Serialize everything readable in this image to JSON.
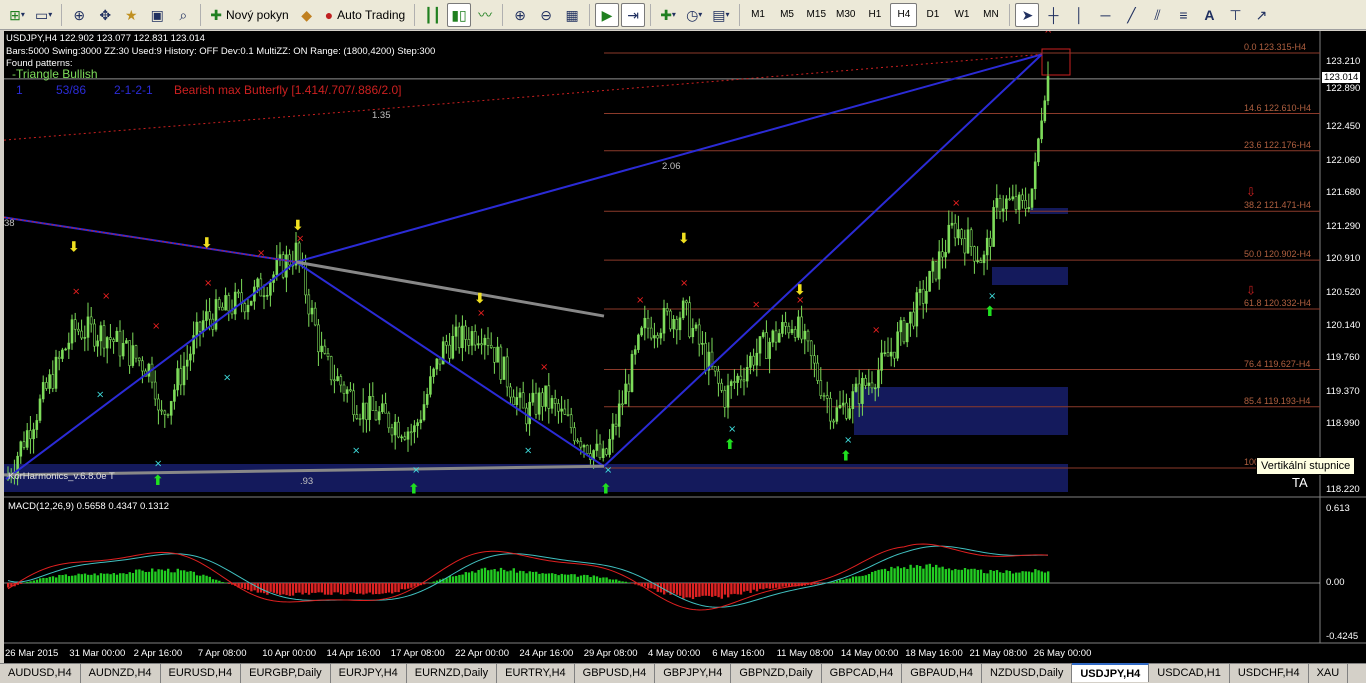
{
  "toolbar": {
    "new_order_label": "Nový pokyn",
    "auto_trading_label": "Auto Trading",
    "timeframes": [
      "M1",
      "M5",
      "M15",
      "M30",
      "H1",
      "H4",
      "D1",
      "W1",
      "MN"
    ],
    "active_timeframe": "H4"
  },
  "chart": {
    "header_line1": "USDJPY,H4  122.902 123.077 122.831 123.014",
    "header_line2": "Bars:5000  Swing:3000  ZZ:30  Used:9  History: OFF Dev:0.1  MultiZZ: ON  Range: (1800,4200)  Step:300",
    "header_line3": "Found patterns:",
    "pattern_name": "-Triangle Bullish",
    "pattern_row": {
      "c1": "1",
      "c2": "53/86",
      "c3": "2-1-2-1",
      "c4": "Bearish max Butterfly [1.414/.707/.886/2.0]"
    },
    "watermark": "KorHarmonics_v.6.8.0e T",
    "ta_label": "TA",
    "ratio_labels": [
      {
        "text": "1.35"
      },
      {
        "text": "2.06"
      },
      {
        "text": ".93"
      },
      {
        "text": "38"
      }
    ],
    "current_price": "123.014",
    "fib_levels": [
      {
        "label": "0.0",
        "price": "123.315-H4",
        "value": 123.315
      },
      {
        "label": "14.6",
        "price": "122.610-H4",
        "value": 122.61
      },
      {
        "label": "23.6",
        "price": "122.176-H4",
        "value": 122.176
      },
      {
        "label": "38.2",
        "price": "121.471-H4",
        "value": 121.471
      },
      {
        "label": "50.0",
        "price": "120.902-H4",
        "value": 120.902
      },
      {
        "label": "61.8",
        "price": "120.332-H4",
        "value": 120.332
      },
      {
        "label": "76.4",
        "price": "119.627-H4",
        "value": 119.627
      },
      {
        "label": "85.4",
        "price": "119.193-H4",
        "value": 119.193
      },
      {
        "label": "100",
        "price": "",
        "value": 118.48
      }
    ],
    "price_axis_ticks": [
      "123.210",
      "122.890",
      "122.450",
      "122.060",
      "121.680",
      "121.290",
      "120.910",
      "120.520",
      "120.140",
      "119.760",
      "119.370",
      "118.990",
      "118.220"
    ],
    "macd_header": "MACD(12,26,9) 0.5658 0.4347 0.1312",
    "macd_axis_ticks": [
      "0.613",
      "0.00",
      "-0.4245"
    ],
    "time_axis_labels": [
      "26 Mar 2015",
      "31 Mar 00:00",
      "2 Apr 16:00",
      "7 Apr 08:00",
      "10 Apr 00:00",
      "14 Apr 16:00",
      "17 Apr 08:00",
      "22 Apr 00:00",
      "24 Apr 16:00",
      "29 Apr 08:00",
      "4 May 00:00",
      "6 May 16:00",
      "11 May 08:00",
      "14 May 00:00",
      "18 May 16:00",
      "21 May 08:00",
      "26 May 00:00"
    ],
    "tooltip": "Vertikální stupnice",
    "colors": {
      "bg": "#000000",
      "candle": "#7ddc5a",
      "pattern": "#2b2bd6",
      "fib": "#8b3a2a",
      "macd_up": "#22cc22",
      "macd_down": "#dd2222"
    }
  },
  "tabs": [
    "AUDUSD,H4",
    "AUDNZD,H4",
    "EURUSD,H4",
    "EURGBP,Daily",
    "EURJPY,H4",
    "EURNZD,Daily",
    "EURTRY,H4",
    "GBPUSD,H4",
    "GBPJPY,H4",
    "GBPNZD,Daily",
    "GBPCAD,H4",
    "GBPAUD,H4",
    "NZDUSD,Daily",
    "USDJPY,H4",
    "USDCAD,H1",
    "USDCHF,H4",
    "XAU"
  ],
  "active_tab": "USDJPY,H4"
}
